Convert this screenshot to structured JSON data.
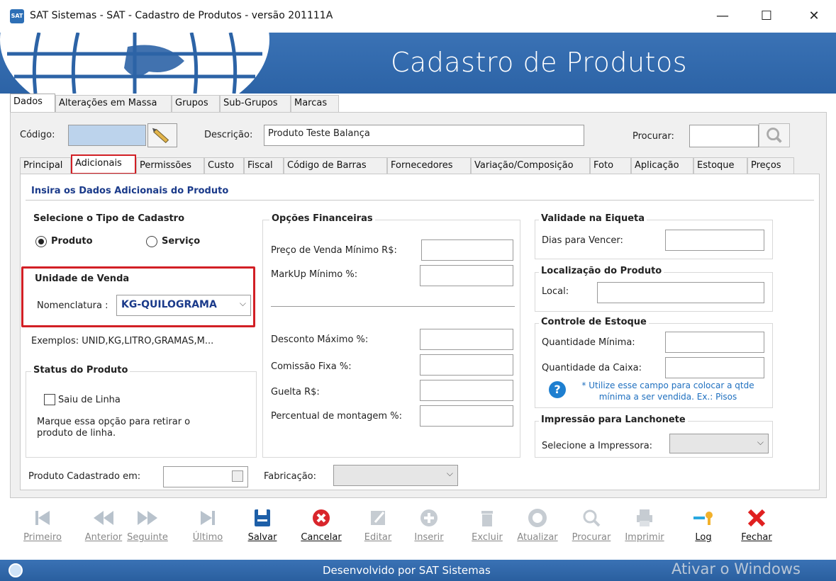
{
  "window": {
    "app_icon": "SAT",
    "title": "SAT Sistemas - SAT - Cadastro de Produtos - versão 201111A",
    "minimize": "—",
    "maximize": "☐",
    "close": "✕"
  },
  "banner": {
    "title": "Cadastro de Produtos"
  },
  "main_tabs": [
    "Dados",
    "Alterações em Massa",
    "Grupos",
    "Sub-Grupos",
    "Marcas"
  ],
  "header_fields": {
    "codigo_label": "Código:",
    "codigo_value": "",
    "descricao_label": "Descrição:",
    "descricao_value": "Produto Teste Balança",
    "procurar_label": "Procurar:",
    "procurar_value": ""
  },
  "sub_tabs": [
    "Principal",
    "Adicionais",
    "Permissões",
    "Custo",
    "Fiscal",
    "Código de Barras",
    "Fornecedores",
    "Variação/Composição",
    "Foto",
    "Aplicação",
    "Estoque",
    "Preços"
  ],
  "panel_title": "Insira os Dados Adicionais do Produto",
  "tipo_cadastro": {
    "title": "Selecione o Tipo de Cadastro",
    "option_produto": "Produto",
    "option_servico": "Serviço",
    "selected": "Produto"
  },
  "unidade_venda": {
    "title": "Unidade de Venda",
    "nomenclatura_label": "Nomenclatura :",
    "nomenclatura_value": "KG-QUILOGRAMA",
    "examples": "Exemplos: UNID,KG,LITRO,GRAMAS,M..."
  },
  "status_produto": {
    "title": "Status do Produto",
    "checkbox_label": "Saiu de Linha",
    "checked": false,
    "help": "Marque essa opção para retirar o produto de linha."
  },
  "opcoes_financeiras": {
    "title": "Opções Financeiras",
    "preco_minimo_label": "Preço de Venda Mínimo R$:",
    "markup_label": "MarkUp Mínimo %:",
    "desconto_label": "Desconto Máximo %:",
    "comissao_label": "Comissão Fixa %:",
    "guelta_label": "Guelta R$:",
    "montagem_label": "Percentual de montagem %:"
  },
  "validade": {
    "title": "Validade na Eiqueta",
    "dias_label": "Dias para Vencer:"
  },
  "localizacao": {
    "title": "Localização do Produto",
    "local_label": "Local:"
  },
  "controle_estoque": {
    "title": "Controle de Estoque",
    "qtd_minima_label": "Quantidade Mínima:",
    "qtd_caixa_label": "Quantidade da Caixa:",
    "hint": "* Utilize esse campo para colocar a qtde mínima a ser vendida. Ex.: Pisos"
  },
  "impressao": {
    "title": "Impressão para Lanchonete",
    "impressora_label": "Selecione a Impressora:"
  },
  "footer_fields": {
    "cadastrado_label": "Produto Cadastrado em:",
    "fabricacao_label": "Fabricação:"
  },
  "toolbar": [
    {
      "label": "Primeiro",
      "icon": "first-icon",
      "enabled": false
    },
    {
      "label": "Anterior",
      "icon": "previous-icon",
      "enabled": false
    },
    {
      "label": "Seguinte",
      "icon": "next-icon",
      "enabled": false
    },
    {
      "label": "Último",
      "icon": "last-icon",
      "enabled": false
    },
    {
      "label": "Salvar",
      "icon": "save-icon",
      "enabled": true
    },
    {
      "label": "Cancelar",
      "icon": "cancel-icon",
      "enabled": true
    },
    {
      "label": "Editar",
      "icon": "edit-icon",
      "enabled": false
    },
    {
      "label": "Inserir",
      "icon": "insert-icon",
      "enabled": false
    },
    {
      "label": "Excluir",
      "icon": "delete-icon",
      "enabled": false
    },
    {
      "label": "Atualizar",
      "icon": "refresh-icon",
      "enabled": false
    },
    {
      "label": "Procurar",
      "icon": "search-icon",
      "enabled": false
    },
    {
      "label": "Imprimir",
      "icon": "print-icon",
      "enabled": false
    },
    {
      "label": "Log",
      "icon": "key-icon",
      "enabled": true
    },
    {
      "label": "Fechar",
      "icon": "close-icon",
      "enabled": true
    }
  ],
  "status_bar": {
    "text": "Desenvolvido por SAT Sistemas",
    "watermark": "Ativar o Windows"
  },
  "colors": {
    "banner": "#2c63a6",
    "highlight": "#d21f25",
    "link": "#1a3a8a"
  }
}
